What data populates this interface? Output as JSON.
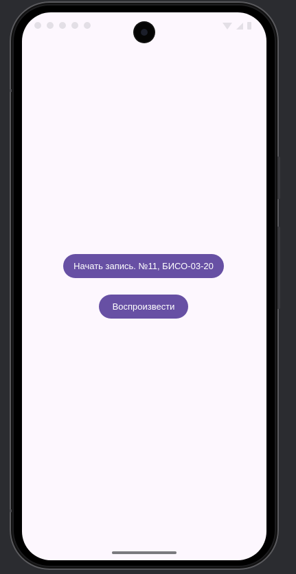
{
  "app": {
    "record_button_label": "Начать запись. №11, БИСО-03-20",
    "play_button_label": "Воспроизвести"
  },
  "status_bar": {
    "left_icons": [
      "notification-icon",
      "notification-icon",
      "notification-icon",
      "notification-icon",
      "notification-icon"
    ],
    "right_icons": [
      "wifi-icon",
      "signal-icon",
      "battery-icon"
    ]
  },
  "colors": {
    "screen_background": "#fdf7fe",
    "button_background": "#6750a4",
    "button_text": "#ffffff",
    "device_background": "#2b2c30"
  }
}
